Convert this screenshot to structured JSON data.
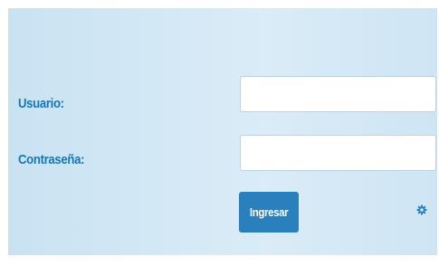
{
  "login": {
    "username_label": "Usuario:",
    "username_value": "",
    "password_label": "Contraseña:",
    "password_value": "",
    "submit_label": "Ingresar",
    "settings_icon": "gear-icon"
  },
  "colors": {
    "label_text": "#1778b9",
    "button_bg": "#2a7fbd",
    "button_text": "#ffffff",
    "panel_bg": "#d6eaf6"
  }
}
